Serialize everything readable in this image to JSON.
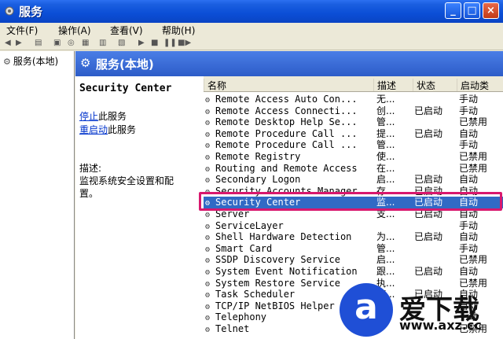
{
  "window": {
    "title": "服务",
    "buttons": {
      "minimize": "_",
      "maximize": "□",
      "close": "×"
    }
  },
  "menu": [
    "文件(F)",
    "操作(A)",
    "查看(V)",
    "帮助(H)"
  ],
  "toolbar": {
    "icons": [
      "back-icon",
      "forward-icon",
      "view-icon",
      "properties-icon",
      "refresh-icon",
      "export-icon",
      "help-icon",
      "play-icon",
      "stop-icon",
      "pause-icon",
      "restart-icon"
    ]
  },
  "tree": {
    "root_label": "服务(本地)"
  },
  "header": {
    "title": "服务(本地)"
  },
  "description": {
    "service_name": "Security Center",
    "stop_link": "停止",
    "stop_suffix": "此服务",
    "restart_link": "重启动",
    "restart_suffix": "此服务",
    "desc_label": "描述:",
    "desc_line1": "监视系统安全设置和配",
    "desc_line2": "置。"
  },
  "list": {
    "columns": {
      "name": "名称",
      "desc": "描述",
      "status": "状态",
      "startup": "启动类"
    },
    "rows": [
      {
        "name": "Remote Access Auto Con...",
        "desc": "无...",
        "status": "",
        "startup": "手动"
      },
      {
        "name": "Remote Access Connecti...",
        "desc": "创...",
        "status": "已启动",
        "startup": "手动"
      },
      {
        "name": "Remote Desktop Help Se...",
        "desc": "管...",
        "status": "",
        "startup": "已禁用"
      },
      {
        "name": "Remote Procedure Call ...",
        "desc": "提...",
        "status": "已启动",
        "startup": "自动"
      },
      {
        "name": "Remote Procedure Call ...",
        "desc": "管...",
        "status": "",
        "startup": "手动"
      },
      {
        "name": "Remote Registry",
        "desc": "使...",
        "status": "",
        "startup": "已禁用"
      },
      {
        "name": "Routing and Remote Access",
        "desc": "在...",
        "status": "",
        "startup": "已禁用"
      },
      {
        "name": "Secondary Logon",
        "desc": "启...",
        "status": "已启动",
        "startup": "自动"
      },
      {
        "name": "Security Accounts Manager",
        "desc": "存...",
        "status": "已启动",
        "startup": "自动"
      },
      {
        "name": "Security Center",
        "desc": "监...",
        "status": "已启动",
        "startup": "自动"
      },
      {
        "name": "Server",
        "desc": "支...",
        "status": "已启动",
        "startup": "自动"
      },
      {
        "name": "ServiceLayer",
        "desc": "",
        "status": "",
        "startup": "手动"
      },
      {
        "name": "Shell Hardware Detection",
        "desc": "为...",
        "status": "已启动",
        "startup": "自动"
      },
      {
        "name": "Smart Card",
        "desc": "管...",
        "status": "",
        "startup": "手动"
      },
      {
        "name": "SSDP Discovery Service",
        "desc": "启...",
        "status": "",
        "startup": "已禁用"
      },
      {
        "name": "System Event Notification",
        "desc": "跟...",
        "status": "已启动",
        "startup": "自动"
      },
      {
        "name": "System Restore Service",
        "desc": "执...",
        "status": "",
        "startup": "已禁用"
      },
      {
        "name": "Task Scheduler",
        "desc": "使...",
        "status": "已启动",
        "startup": "自动"
      },
      {
        "name": "TCP/IP NetBIOS Helper",
        "desc": "",
        "status": "",
        "startup": "自动"
      },
      {
        "name": "Telephony",
        "desc": "",
        "status": "",
        "startup": "手动"
      },
      {
        "name": "Telnet",
        "desc": "",
        "status": "",
        "startup": "已禁用"
      }
    ],
    "selected_index": 9
  },
  "watermark": {
    "logo": "a",
    "text": "爱下载",
    "url": "www.axz.cc"
  },
  "colors": {
    "title_blue": "#0b4ed6",
    "selection": "#316ac5",
    "highlight_box": "#d8186e",
    "watermark_blue": "#1f4fd6"
  }
}
